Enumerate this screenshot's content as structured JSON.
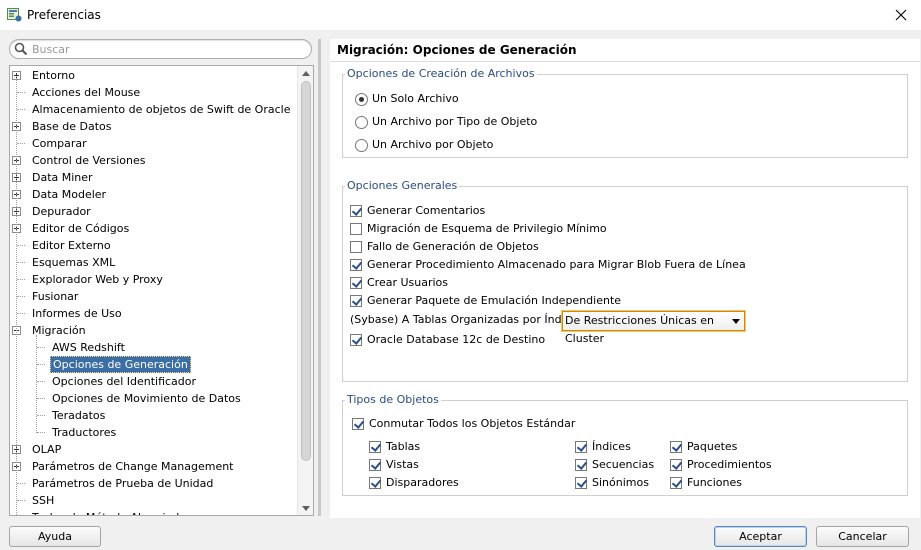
{
  "window": {
    "title": "Preferencias"
  },
  "search": {
    "placeholder": "Buscar",
    "value": ""
  },
  "tree": {
    "items": [
      {
        "label": "Entorno",
        "expander": "plus",
        "level": 0
      },
      {
        "label": "Acciones del Mouse",
        "expander": "none",
        "level": 0
      },
      {
        "label": "Almacenamiento de objetos de Swift de Oracle",
        "expander": "none",
        "level": 0
      },
      {
        "label": "Base de Datos",
        "expander": "plus",
        "level": 0
      },
      {
        "label": "Comparar",
        "expander": "none",
        "level": 0
      },
      {
        "label": "Control de Versiones",
        "expander": "plus",
        "level": 0
      },
      {
        "label": "Data Miner",
        "expander": "plus",
        "level": 0
      },
      {
        "label": "Data Modeler",
        "expander": "plus",
        "level": 0
      },
      {
        "label": "Depurador",
        "expander": "plus",
        "level": 0
      },
      {
        "label": "Editor de Códigos",
        "expander": "plus",
        "level": 0
      },
      {
        "label": "Editor Externo",
        "expander": "none",
        "level": 0
      },
      {
        "label": "Esquemas XML",
        "expander": "none",
        "level": 0
      },
      {
        "label": "Explorador Web y Proxy",
        "expander": "none",
        "level": 0
      },
      {
        "label": "Fusionar",
        "expander": "none",
        "level": 0
      },
      {
        "label": "Informes de Uso",
        "expander": "none",
        "level": 0
      },
      {
        "label": "Migración",
        "expander": "minus",
        "level": 0
      },
      {
        "label": "AWS Redshift",
        "expander": "none",
        "level": 1
      },
      {
        "label": "Opciones de Generación",
        "expander": "none",
        "level": 1,
        "selected": true
      },
      {
        "label": "Opciones del Identificador",
        "expander": "none",
        "level": 1
      },
      {
        "label": "Opciones de Movimiento de Datos",
        "expander": "none",
        "level": 1
      },
      {
        "label": "Teradatos",
        "expander": "none",
        "level": 1
      },
      {
        "label": "Traductores",
        "expander": "none",
        "level": 1
      },
      {
        "label": "OLAP",
        "expander": "plus",
        "level": 0
      },
      {
        "label": "Parámetros de Change Management",
        "expander": "plus",
        "level": 0
      },
      {
        "label": "Parámetros de Prueba de Unidad",
        "expander": "none",
        "level": 0
      },
      {
        "label": "SSH",
        "expander": "none",
        "level": 0
      },
      {
        "label": "Teclas de Método Abreviado",
        "expander": "none",
        "level": 0
      }
    ]
  },
  "panel": {
    "title": "Migración: Opciones de Generación",
    "file_group": {
      "label": "Opciones de Creación de Archivos",
      "options": [
        {
          "label": "Un Solo Archivo",
          "selected": true
        },
        {
          "label": "Un Archivo por Tipo de Objeto",
          "selected": false
        },
        {
          "label": "Un Archivo por Objeto",
          "selected": false
        }
      ]
    },
    "general_group": {
      "label": "Opciones Generales",
      "checks": [
        {
          "label": "Generar Comentarios",
          "checked": true
        },
        {
          "label": "Migración de Esquema de Privilegio Mínimo",
          "checked": false
        },
        {
          "label": "Fallo de Generación de Objetos",
          "checked": false
        },
        {
          "label": "Generar Procedimiento Almacenado para Migrar Blob Fuera de Línea",
          "checked": true
        },
        {
          "label": "Crear Usuarios",
          "checked": true
        },
        {
          "label": "Generar Paquete de Emulación Independiente",
          "checked": true
        }
      ],
      "sybase_label": "(Sybase) A Tablas Organizadas por Índices",
      "sybase_value": "De Restricciones Únicas en Cluster",
      "oracle12c": {
        "label": "Oracle Database 12c de Destino",
        "checked": true
      }
    },
    "types_group": {
      "label": "Tipos de Objetos",
      "toggle_all": {
        "label": "Conmutar Todos los Objetos Estándar",
        "checked": true
      },
      "types": [
        {
          "label": "Tablas",
          "checked": true
        },
        {
          "label": "Vistas",
          "checked": true
        },
        {
          "label": "Disparadores",
          "checked": true
        },
        {
          "label": "Índices",
          "checked": true
        },
        {
          "label": "Secuencias",
          "checked": true
        },
        {
          "label": "Sinónimos",
          "checked": true
        },
        {
          "label": "Paquetes",
          "checked": true
        },
        {
          "label": "Procedimientos",
          "checked": true
        },
        {
          "label": "Funciones",
          "checked": true
        }
      ]
    }
  },
  "buttons": {
    "help": "Ayuda",
    "ok": "Aceptar",
    "cancel": "Cancelar"
  }
}
